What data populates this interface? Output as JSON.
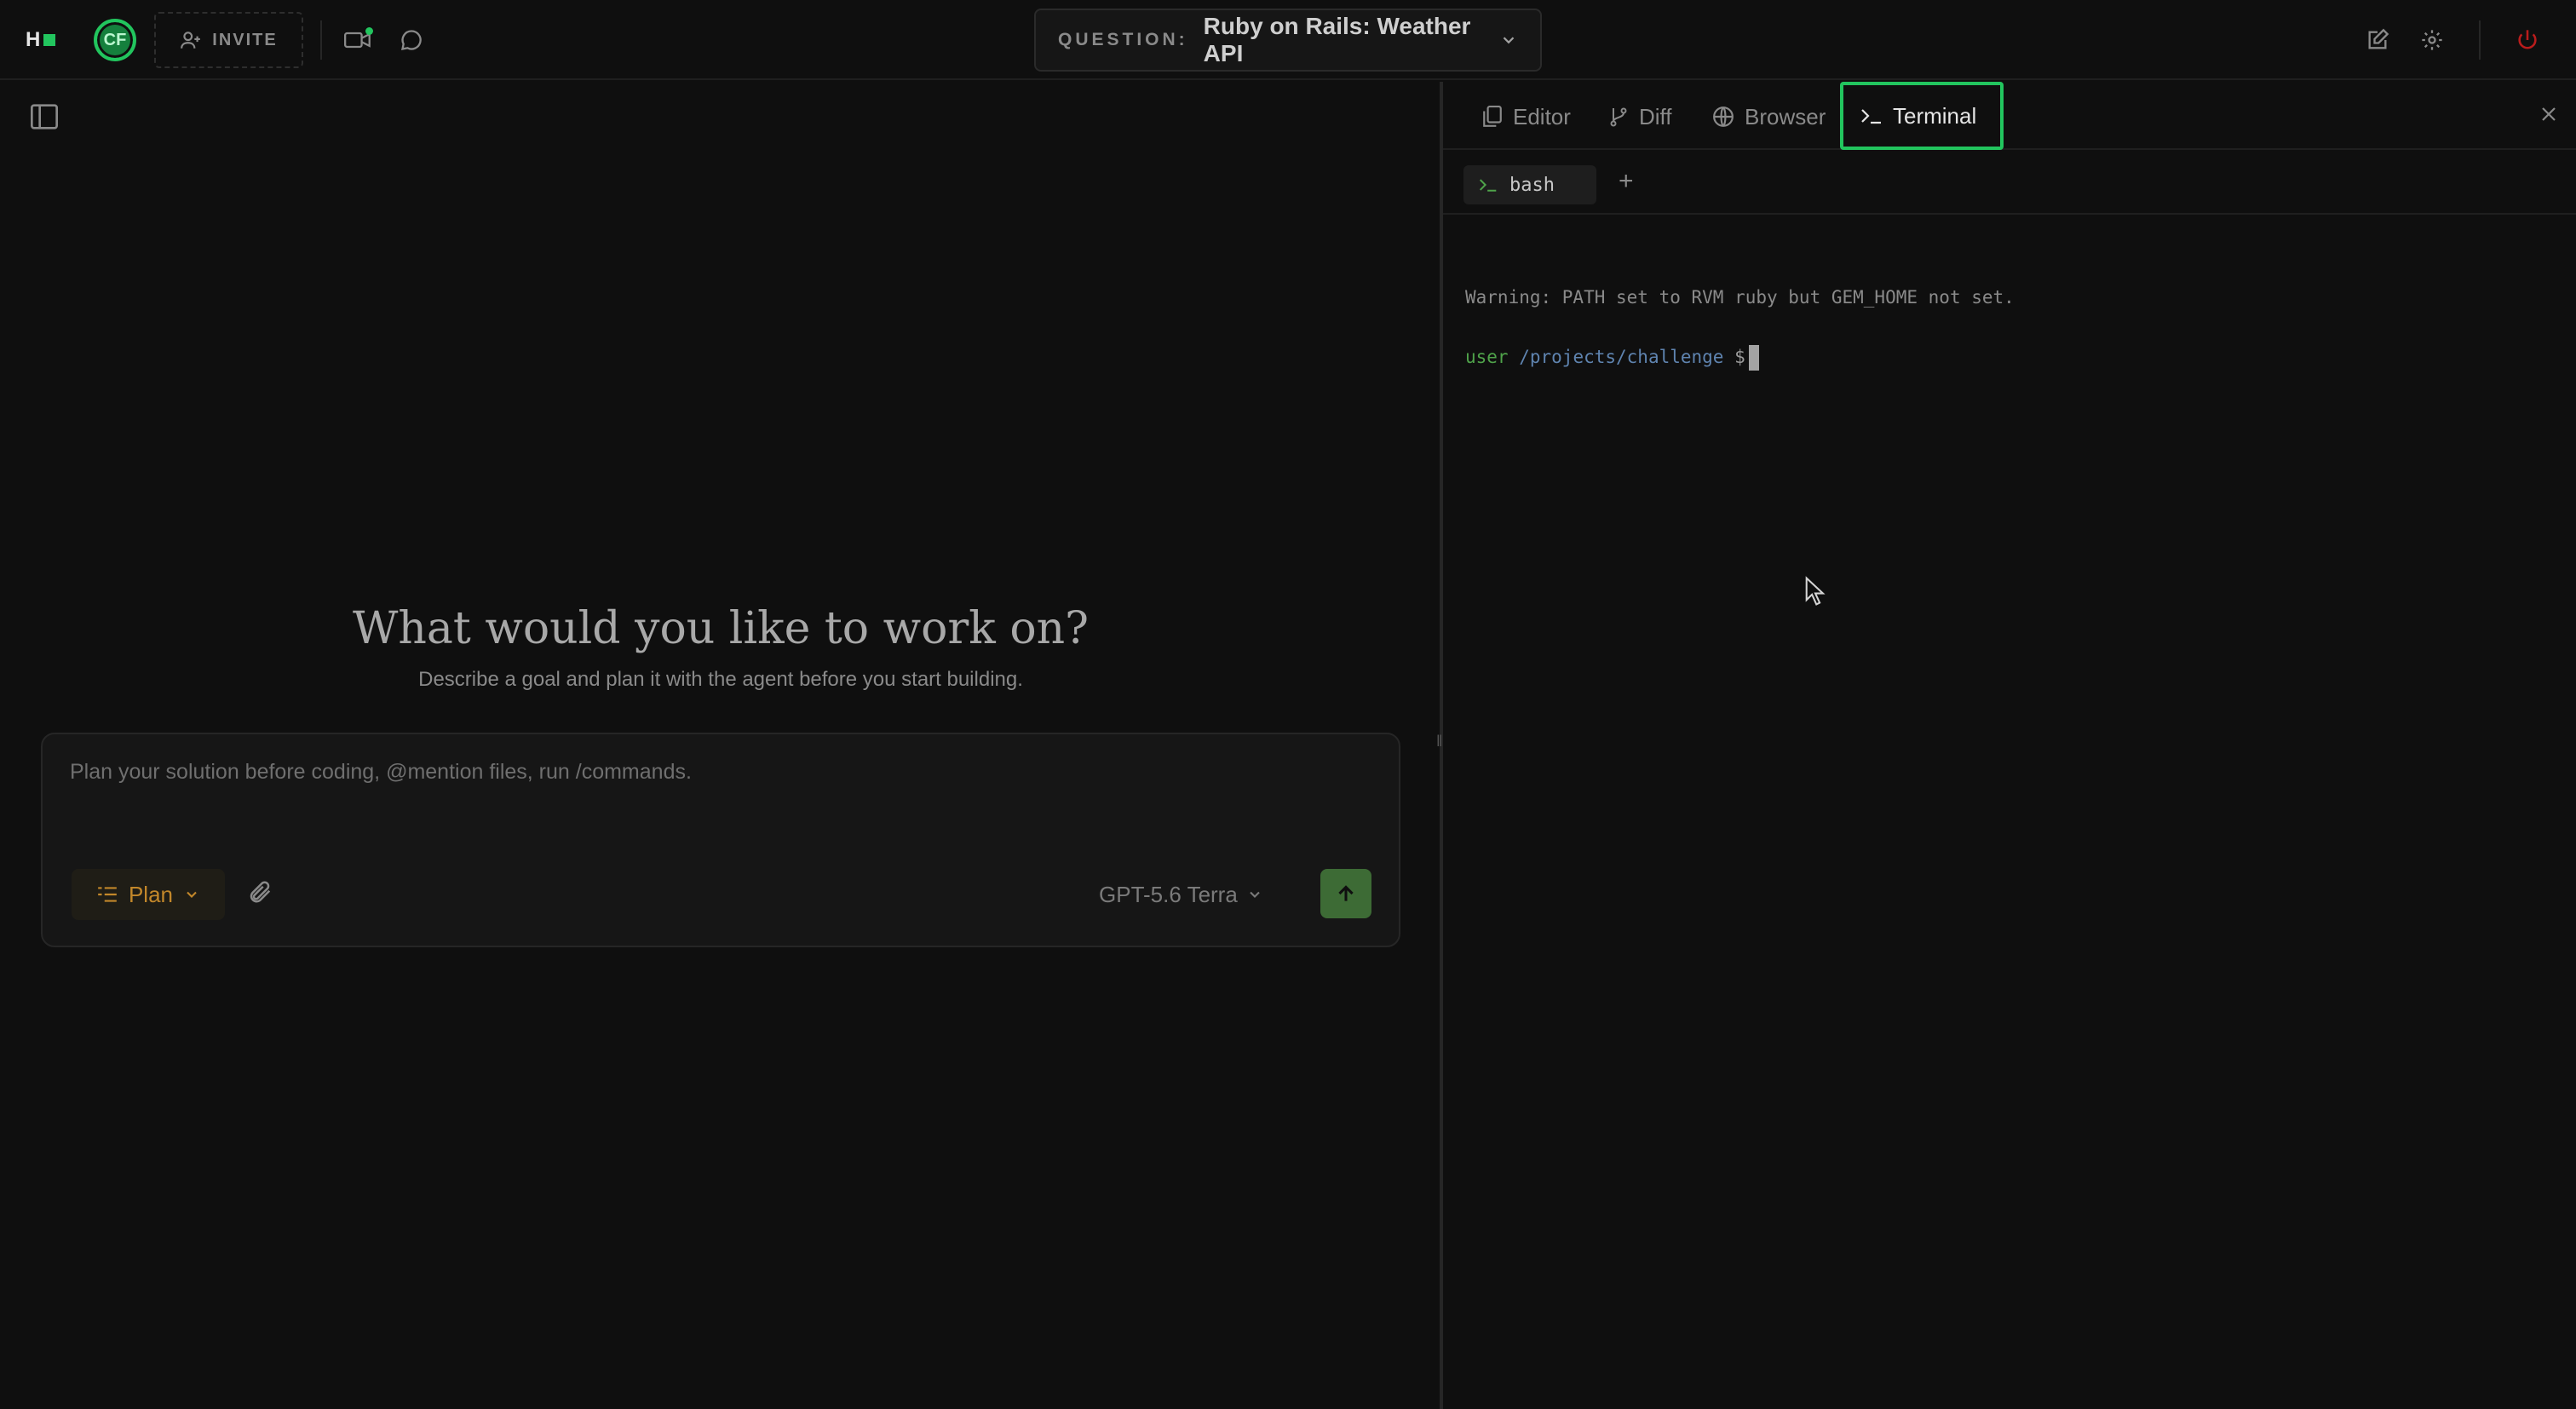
{
  "topbar": {
    "logo_text": "H",
    "avatar_initials": "CF",
    "invite_label": "INVITE",
    "question_label": "QUESTION:",
    "question_title": "Ruby on Rails: Weather API"
  },
  "main": {
    "title": "What would you like to work on?",
    "subtitle": "Describe a goal and plan it with the agent before you start building.",
    "composer_placeholder": "Plan your solution before coding, @mention files, run /commands.",
    "mode_label": "Plan",
    "model_label": "GPT-5.6 Terra"
  },
  "panel": {
    "tabs": [
      {
        "label": "Editor",
        "icon": "file-icon"
      },
      {
        "label": "Diff",
        "icon": "git-branch-icon"
      },
      {
        "label": "Browser",
        "icon": "globe-icon"
      },
      {
        "label": "Terminal",
        "icon": "terminal-icon",
        "active": true
      }
    ],
    "terminal_tab_label": "bash",
    "terminal_lines": {
      "warning": "Warning: PATH set to RVM ruby but GEM_HOME not set.",
      "user": "user",
      "path": "/projects/challenge",
      "symbol": "$"
    }
  },
  "colors": {
    "accent": "#22c55e",
    "plan": "#c2872a",
    "send": "#3d6b35",
    "power": "#b91c1c"
  }
}
